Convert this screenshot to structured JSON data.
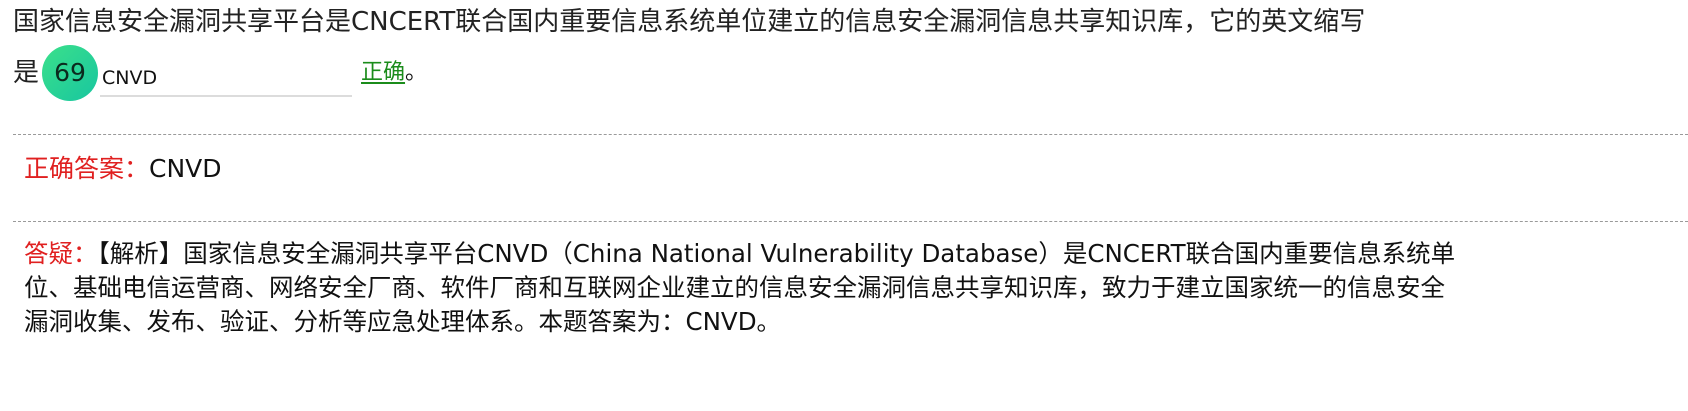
{
  "question": {
    "text_line1": "国家信息安全漏洞共享平台是CNCERT联合国内重要信息系统单位建立的信息安全漏洞信息共享知识库，它的英文缩写",
    "text_prefix": "是",
    "badge_number": "69",
    "input_value": "CNVD",
    "verdict": "正确",
    "suffix": "。"
  },
  "correct_answer": {
    "label": "正确答案：",
    "value": "CNVD"
  },
  "explanation": {
    "label": "答疑：",
    "lines": [
      "【解析】国家信息安全漏洞共享平台CNVD（China National Vulnerability Database）是CNCERT联合国内重要信息系统单",
      "位、基础电信运营商、网络安全厂商、软件厂商和互联网企业建立的信息安全漏洞信息共享知识库，致力于建立国家统一的信息安全",
      "漏洞收集、发布、验证、分析等应急处理体系。本题答案为：CNVD。"
    ]
  },
  "colors": {
    "label_red": "#e02020",
    "verdict_green": "#1b8c1b",
    "badge_gradient_start": "#3be08a",
    "badge_gradient_end": "#18c6a0"
  }
}
